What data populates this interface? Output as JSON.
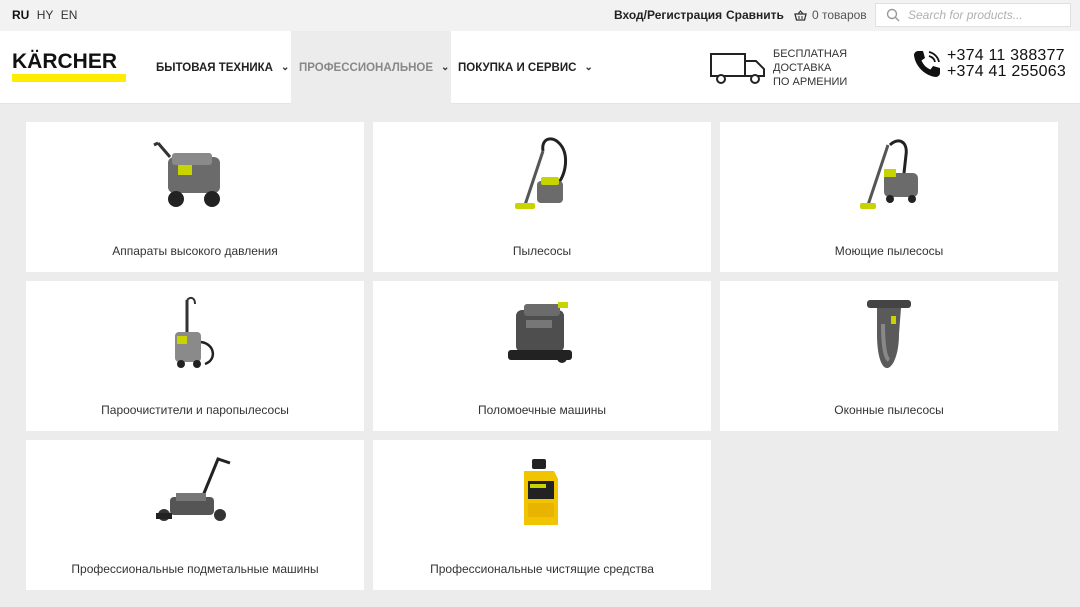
{
  "topbar": {
    "languages": [
      {
        "code": "RU",
        "active": true
      },
      {
        "code": "HY",
        "active": false
      },
      {
        "code": "EN",
        "active": false
      }
    ],
    "login_label": "Вход/Регистрация",
    "compare_label": "Сравнить",
    "cart_label": "0 товаров",
    "search_placeholder": "Search for products..."
  },
  "header": {
    "logo_text": "KÄRCHER",
    "nav": [
      {
        "label": "БЫТОВАЯ ТЕХНИКА"
      },
      {
        "label": "ПРОФЕССИОНАЛЬНОЕ"
      },
      {
        "label": "ПОКУПКА И СЕРВИС"
      }
    ],
    "delivery_line1": "БЕСПЛАТНАЯ ДОСТАВКА",
    "delivery_line2": "ПО АРМЕНИИ",
    "phone_1": "+374 11 388377",
    "phone_2": "+374 41 255063"
  },
  "categories": [
    {
      "label": "Аппараты высокого давления",
      "icon": "pressure-washer-icon"
    },
    {
      "label": "Пылесосы",
      "icon": "vacuum-cleaner-icon"
    },
    {
      "label": "Моющие пылесосы",
      "icon": "washing-vacuum-icon"
    },
    {
      "label": "Пароочистители и паропылесосы",
      "icon": "steam-cleaner-icon"
    },
    {
      "label": "Поломоечные машины",
      "icon": "scrubber-dryer-icon"
    },
    {
      "label": "Оконные пылесосы",
      "icon": "window-vacuum-icon"
    },
    {
      "label": "Профессиональные подметальные машины",
      "icon": "sweeper-icon"
    },
    {
      "label": "Профессиональные чистящие средства",
      "icon": "detergent-bottle-icon"
    }
  ],
  "colors": {
    "brand_yellow": "#ffed00",
    "background": "#ececec"
  }
}
